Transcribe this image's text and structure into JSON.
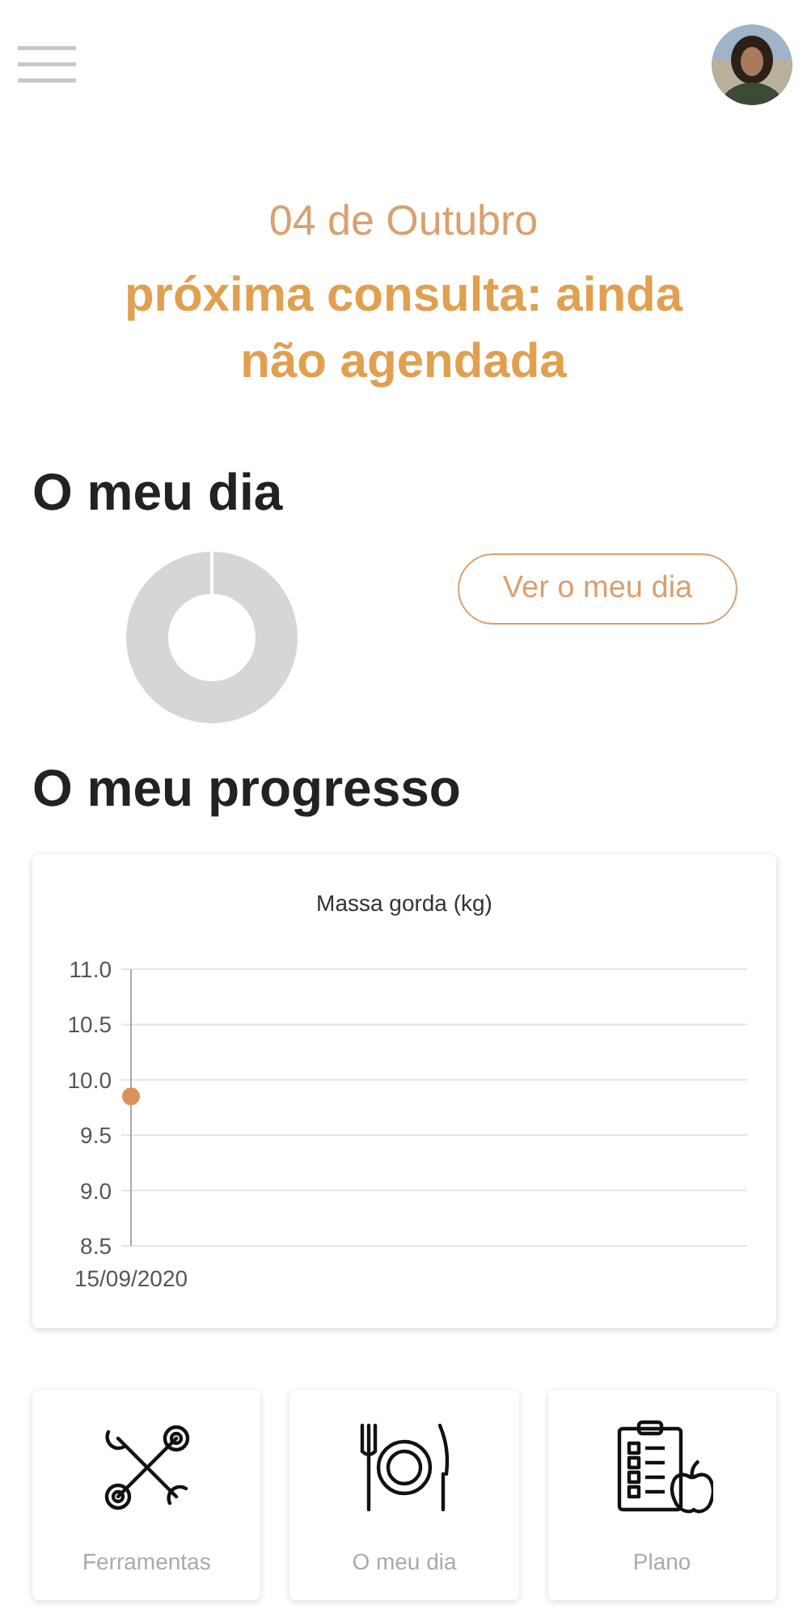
{
  "date": "04 de Outubro",
  "next_appointment": "próxima consulta: ainda não agendada",
  "my_day": {
    "title": "O meu dia",
    "button": "Ver o meu dia"
  },
  "progress": {
    "title": "O meu progresso",
    "chart_data": {
      "type": "line",
      "title": "Massa gorda (kg)",
      "categories": [
        "15/09/2020"
      ],
      "grid": true,
      "series": [
        {
          "color": "#d9935a",
          "marker": true,
          "values": [
            9.85
          ]
        }
      ],
      "ylim": [
        8.5,
        11.0
      ],
      "yticks": [
        {
          "value": 8.5,
          "label": "8.5"
        },
        {
          "value": 9,
          "label": "9.0"
        },
        {
          "value": 9.5,
          "label": "9.5"
        },
        {
          "value": 10,
          "label": "10.0"
        },
        {
          "value": 10.5,
          "label": "10.5"
        },
        {
          "value": 11,
          "label": "11.0"
        }
      ]
    }
  },
  "shortcuts": [
    {
      "kind": "tools",
      "label": "Ferramentas"
    },
    {
      "kind": "meal",
      "label": "O meu dia"
    },
    {
      "kind": "plan",
      "label": "Plano"
    }
  ]
}
